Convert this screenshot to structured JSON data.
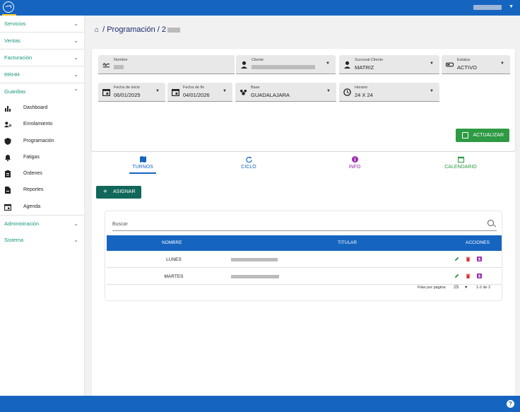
{
  "colors": {
    "primary": "#1565c0",
    "teal": "#10675a",
    "green": "#2e9a44",
    "sidebar_text": "#16967e"
  },
  "sidebar": {
    "menus": [
      {
        "label": "Servicios"
      },
      {
        "label": "Ventas"
      },
      {
        "label": "Facturación"
      },
      {
        "label": "RRHH"
      },
      {
        "label": "Guardias"
      }
    ],
    "guardias_items": [
      {
        "label": "Dashboard",
        "icon": "bar-chart-icon"
      },
      {
        "label": "Enrolamiento",
        "icon": "person-key-icon"
      },
      {
        "label": "Programación",
        "icon": "shield-icon"
      },
      {
        "label": "Fatigas",
        "icon": "bell-icon"
      },
      {
        "label": "Órdenes",
        "icon": "clipboard-icon"
      },
      {
        "label": "Reportes",
        "icon": "report-icon"
      },
      {
        "label": "Agenda",
        "icon": "calendar-icon"
      }
    ],
    "bottom_menus": [
      {
        "label": "Administración"
      },
      {
        "label": "Sistema"
      }
    ]
  },
  "breadcrumb": {
    "prefix": "/ Programación / 2"
  },
  "form": {
    "nombre_label": "Nombre",
    "cliente_label": "Cliente",
    "sucursal_label": "Sucursal Cliente",
    "sucursal_value": "MATRIZ",
    "estatus_label": "Estatus",
    "estatus_value": "ACTIVO",
    "fecha_inicio_label": "Fecha de inicio",
    "fecha_inicio_value": "06/01/2025",
    "fecha_fin_label": "Fecha de fin",
    "fecha_fin_value": "04/01/2026",
    "base_label": "Base",
    "base_value": "GUADALAJARA",
    "horario_label": "Horario",
    "horario_value": "24 X 24",
    "update_label": "ACTUALIZAR"
  },
  "tabs": [
    {
      "label": "TURNOS",
      "color": "#1565c0"
    },
    {
      "label": "CICLO",
      "color": "#1565c0"
    },
    {
      "label": "INFO",
      "color": "#9c27b0"
    },
    {
      "label": "CALENDARIO",
      "color": "#2e9a44"
    }
  ],
  "assign_label": "ASIGNAR",
  "table": {
    "search_placeholder": "Buscar",
    "columns": [
      "NOMBRE",
      "TITULAR",
      "ACCIONES"
    ],
    "rows": [
      {
        "nombre": "LUNES"
      },
      {
        "nombre": "MARTES"
      }
    ],
    "rows_per_page_label": "Filas por página:",
    "rows_per_page": "25",
    "range": "1-2 de 2"
  }
}
